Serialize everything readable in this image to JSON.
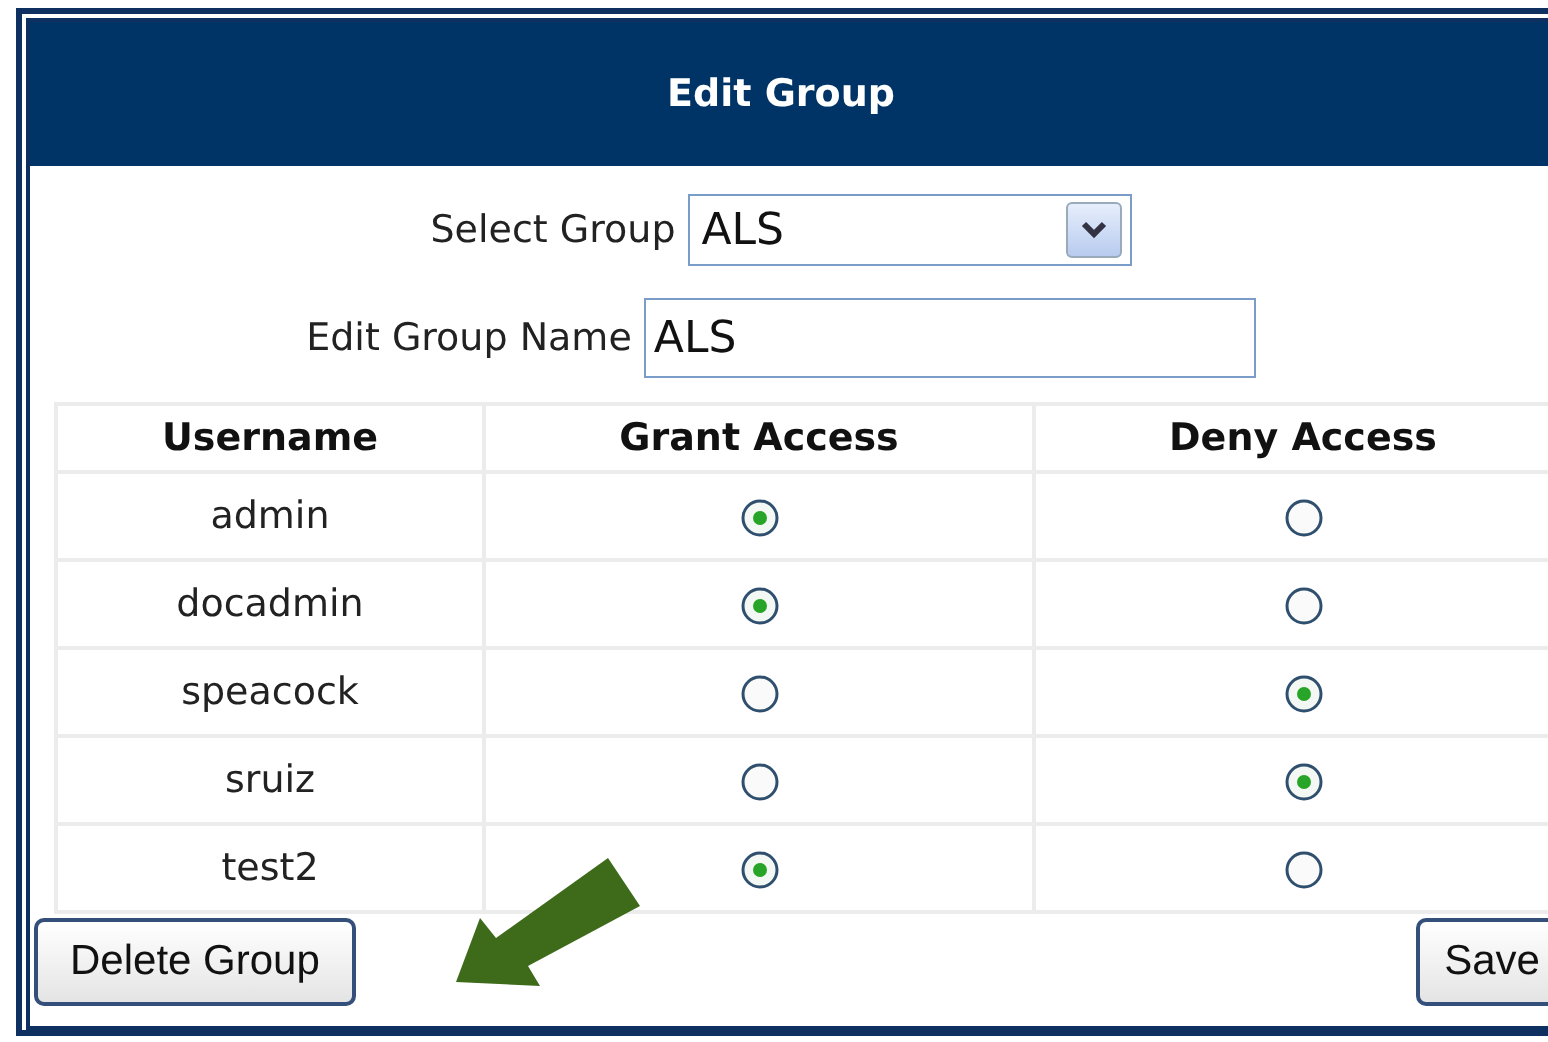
{
  "panel": {
    "title": "Edit Group"
  },
  "select_group": {
    "label": "Select Group",
    "value": "ALS"
  },
  "group_name": {
    "label": "Edit Group Name",
    "value": "ALS"
  },
  "table": {
    "columns": [
      "Username",
      "Grant Access",
      "Deny Access"
    ],
    "rows": [
      {
        "username": "admin",
        "options": [
          {
            "selected": true
          },
          {
            "selected": false
          }
        ]
      },
      {
        "username": "docadmin",
        "options": [
          {
            "selected": true
          },
          {
            "selected": false
          }
        ]
      },
      {
        "username": "speacock",
        "options": [
          {
            "selected": false
          },
          {
            "selected": true
          }
        ]
      },
      {
        "username": "sruiz",
        "options": [
          {
            "selected": false
          },
          {
            "selected": true
          }
        ]
      },
      {
        "username": "test2",
        "options": [
          {
            "selected": true
          },
          {
            "selected": false
          }
        ]
      }
    ]
  },
  "buttons": [
    "Delete Group",
    "Save"
  ]
}
